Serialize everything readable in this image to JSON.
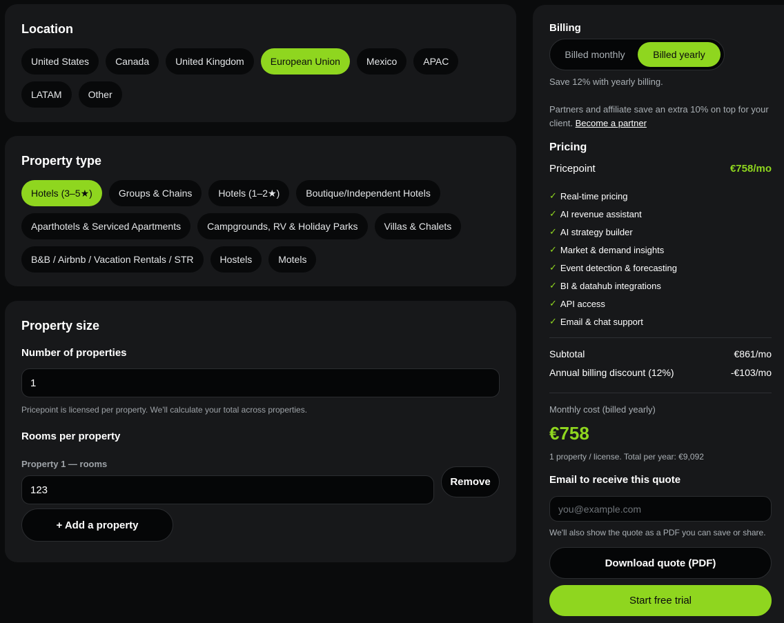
{
  "location": {
    "title": "Location",
    "options": [
      "United States",
      "Canada",
      "United Kingdom",
      "European Union",
      "Mexico",
      "APAC",
      "LATAM",
      "Other"
    ],
    "selected": "European Union"
  },
  "property_type": {
    "title": "Property type",
    "options": [
      "Hotels (3–5★)",
      "Groups & Chains",
      "Hotels (1–2★)",
      "Boutique/Independent Hotels",
      "Aparthotels & Serviced Apartments",
      "Campgrounds, RV & Holiday Parks",
      "Villas & Chalets",
      "B&B / Airbnb / Vacation Rentals / STR",
      "Hostels",
      "Motels"
    ],
    "selected": "Hotels (3–5★)"
  },
  "property_size": {
    "title": "Property size",
    "num_label": "Number of properties",
    "num_value": "1",
    "num_hint": "Pricepoint is licensed per property. We'll calculate your total across properties.",
    "rooms_label": "Rooms per property",
    "property_label": "Property 1 — rooms",
    "rooms_value": "123",
    "remove_label": "Remove",
    "add_label": "+ Add a property"
  },
  "billing": {
    "title": "Billing",
    "monthly_label": "Billed monthly",
    "yearly_label": "Billed yearly",
    "selected": "yearly",
    "save_note": "Save 12% with yearly billing.",
    "partner_note": "Partners and affiliate save an extra 10% on top for your client.",
    "partner_link": "Become a partner"
  },
  "pricing": {
    "title": "Pricing",
    "product_name": "Pricepoint",
    "product_price": "€758/mo",
    "features": [
      "Real-time pricing",
      "AI revenue assistant",
      "AI strategy builder",
      "Market & demand insights",
      "Event detection & forecasting",
      "BI & datahub integrations",
      "API access",
      "Email & chat support"
    ],
    "check_glyph": "✓",
    "subtotal_label": "Subtotal",
    "subtotal_value": "€861/mo",
    "discount_label": "Annual billing discount (12%)",
    "discount_value": "-€103/mo",
    "monthly_cost_label": "Monthly cost (billed yearly)",
    "monthly_cost_value": "€758",
    "license_note": "1 property / license. Total per year: €9,092"
  },
  "quote": {
    "email_label": "Email to receive this quote",
    "email_placeholder": "you@example.com",
    "email_hint": "We'll also show the quote as a PDF you can save or share.",
    "download_label": "Download quote (PDF)",
    "trial_label": "Start free trial"
  },
  "colors": {
    "accent": "#8fd61f",
    "background": "#0a0b0c",
    "card": "#17181a",
    "chip": "#08090a"
  }
}
